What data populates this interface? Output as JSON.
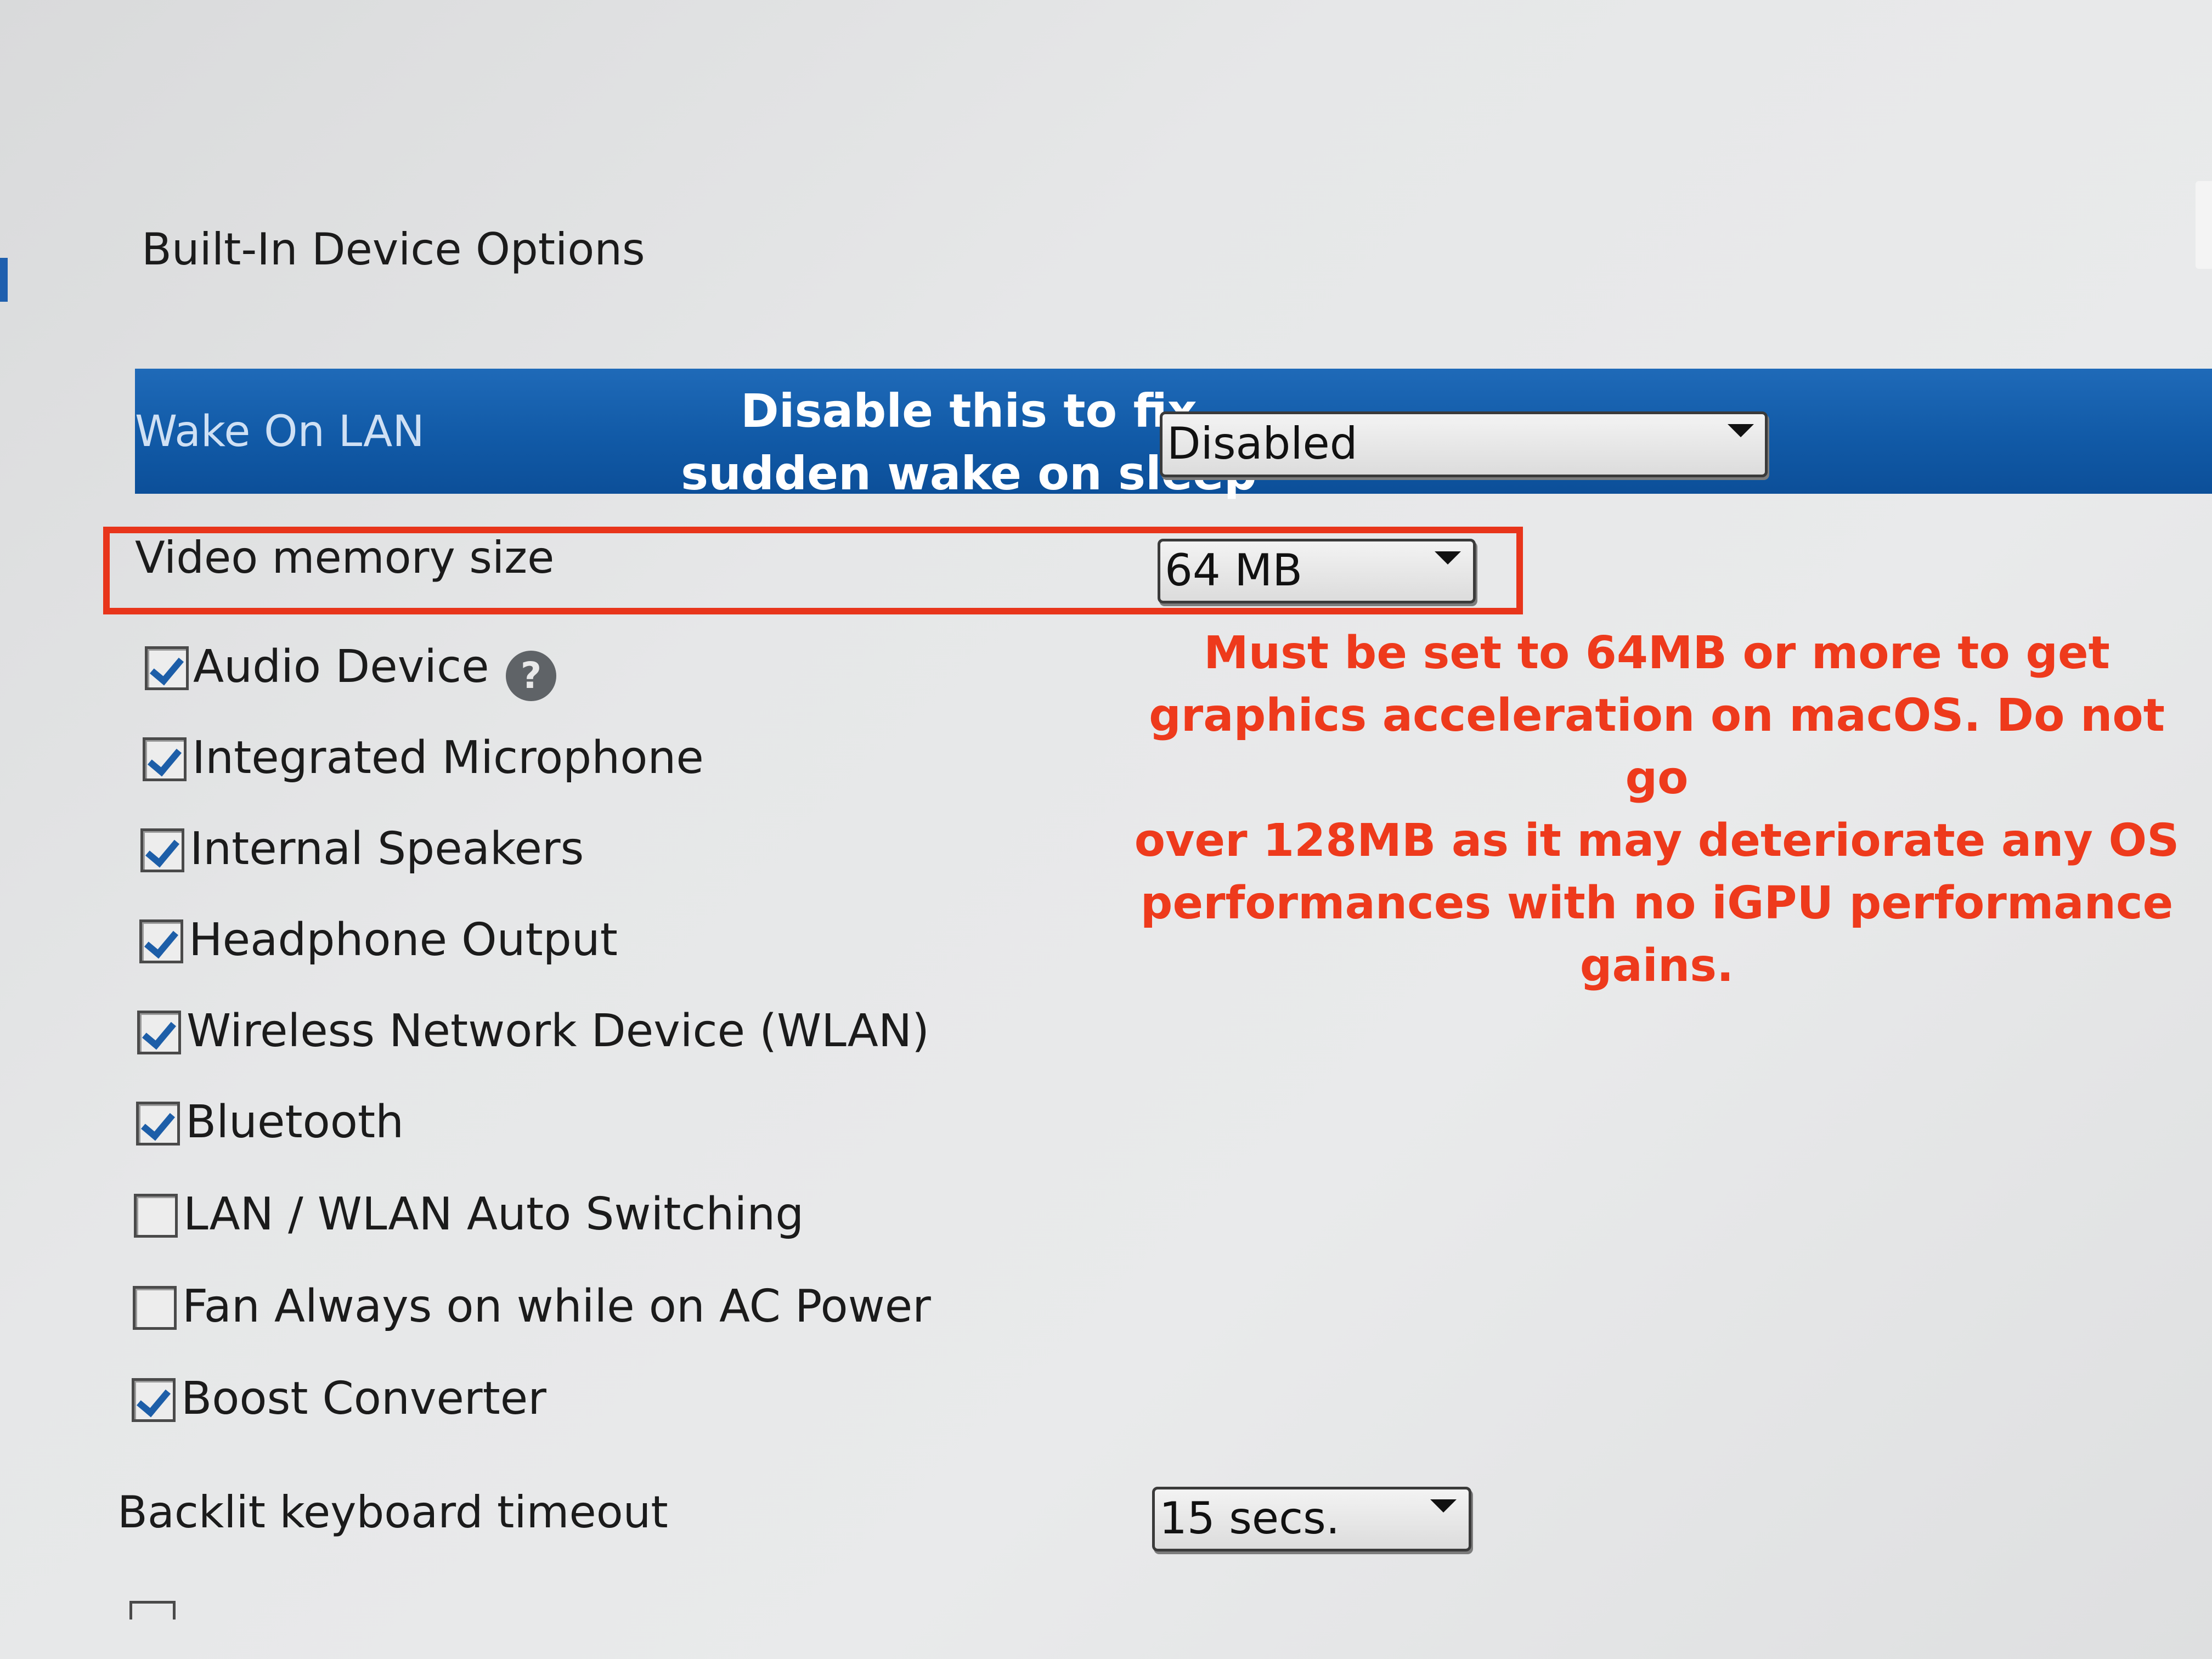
{
  "section_title": "Built-In Device Options",
  "wake_on_lan": {
    "label": "Wake On LAN",
    "value": "Disabled",
    "note_line1": "Disable this to fix",
    "note_line2": "sudden wake on sleep"
  },
  "video_memory": {
    "label": "Video memory size",
    "value": "64 MB",
    "note_lines": [
      "Must be set to 64MB or more to get",
      "graphics acceleration on macOS. Do not go",
      "over 128MB as it may deteriorate any OS",
      "performances with no iGPU performance",
      "gains."
    ]
  },
  "devices": [
    {
      "label": "Audio Device",
      "checked": true,
      "help": "?"
    },
    {
      "label": "Integrated Microphone",
      "checked": true
    },
    {
      "label": "Internal Speakers",
      "checked": true
    },
    {
      "label": "Headphone Output",
      "checked": true
    },
    {
      "label": "Wireless Network Device (WLAN)",
      "checked": true
    },
    {
      "label": "Bluetooth",
      "checked": true
    },
    {
      "label": "LAN / WLAN Auto Switching",
      "checked": false
    },
    {
      "label": "Fan Always on while on AC Power",
      "checked": false
    },
    {
      "label": "Boost Converter",
      "checked": true
    }
  ],
  "backlit_keyboard": {
    "label": "Backlit keyboard timeout",
    "value": "15 secs."
  },
  "colors": {
    "highlight_bar": "#115aa7",
    "annotation_red": "#ee3a1c",
    "checkmark": "#1d5ea8"
  }
}
